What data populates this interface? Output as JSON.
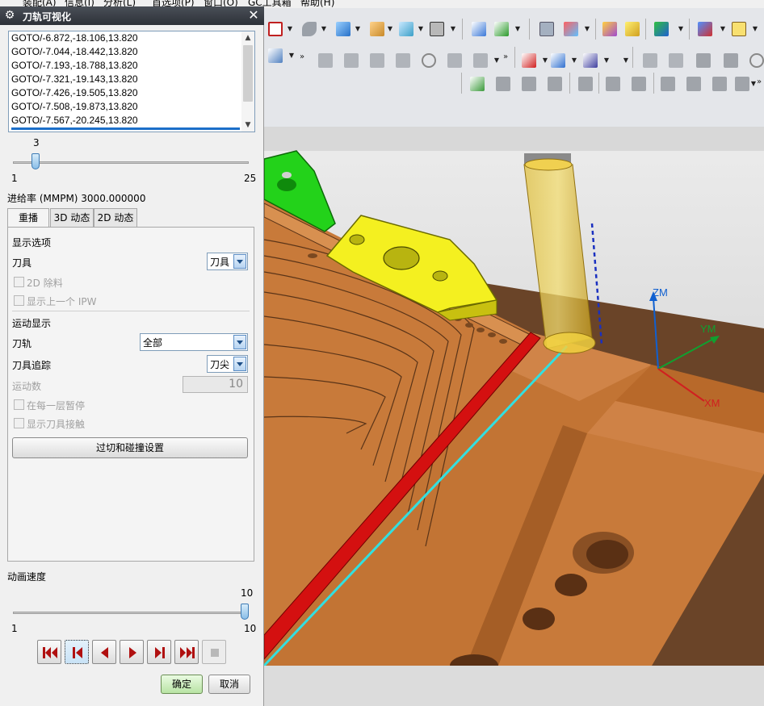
{
  "menubar": {
    "items": [
      "装配(A)",
      "信息(I)",
      "分析(L)",
      "首选项(P)",
      "窗口(O)",
      "GC工具箱",
      "帮助(H)"
    ]
  },
  "dialog": {
    "title": "刀轨可视化",
    "cl_lines": [
      "GOTO/-6.872,-18.106,13.820",
      "GOTO/-7.044,-18.442,13.820",
      "GOTO/-7.193,-18.788,13.820",
      "GOTO/-7.321,-19.143,13.820",
      "GOTO/-7.426,-19.505,13.820",
      "GOTO/-7.508,-19.873,13.820",
      "GOTO/-7.567,-20.245,13.820"
    ],
    "step_slider": {
      "value": "3",
      "min": "1",
      "max": "25",
      "fraction": 0.083
    },
    "feed_rate_label": "进给率 (MMPM) 3000.000000",
    "tabs": [
      "重播",
      "3D 动态",
      "2D 动态"
    ],
    "active_tab": 0,
    "display_options": {
      "header": "显示选项",
      "tool_label": "刀具",
      "tool_value": "刀具",
      "remove_2d_label": "2D 除料",
      "show_prev_ipw_label": "显示上一个 IPW"
    },
    "motion_display": {
      "header": "运动显示",
      "toolpath_label": "刀轨",
      "toolpath_value": "全部",
      "tool_trace_label": "刀具追踪",
      "tool_trace_value": "刀尖",
      "motion_count_label": "运动数",
      "motion_count_value": "10",
      "pause_each_layer_label": "在每一层暂停",
      "show_tool_contact_label": "显示刀具接触",
      "gouge_check_button": "过切和碰撞设置"
    },
    "animation_speed": {
      "label": "动画速度",
      "value": "10",
      "min": "1",
      "max": "10",
      "fraction": 1.0
    },
    "ok_label": "确定",
    "cancel_label": "取消"
  },
  "viewport": {
    "axis_labels": {
      "z": "ZM",
      "y": "YM",
      "x": "XM"
    },
    "colors": {
      "part": "#c87a3a",
      "fixture_green": "#23d21a",
      "fixture_yellow": "#f4f020",
      "tool": "#d8b430",
      "path_cyan": "#32e0e0",
      "path_red": "#d41010",
      "axis_z": "#1060d0",
      "axis_y": "#10a030",
      "axis_x": "#d02020"
    }
  }
}
